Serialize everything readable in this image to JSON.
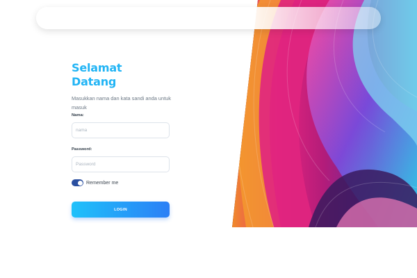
{
  "login": {
    "title": "Selamat Datang",
    "subtitle": "Masukkan nama dan kata sandi anda untuk masuk",
    "name_label": "Nama:",
    "name_placeholder": "nama",
    "password_label": "Password:",
    "password_placeholder": "Password",
    "remember_label": "Remember me",
    "remember_checked": true,
    "login_button": "LOGIN"
  },
  "colors": {
    "accent": "#21b4f5",
    "button_gradient": [
      "#1fc1fa",
      "#2b7ff6"
    ],
    "toggle": "#2a4fa0"
  },
  "icons": {
    "toggle": "toggle-switch-icon"
  }
}
